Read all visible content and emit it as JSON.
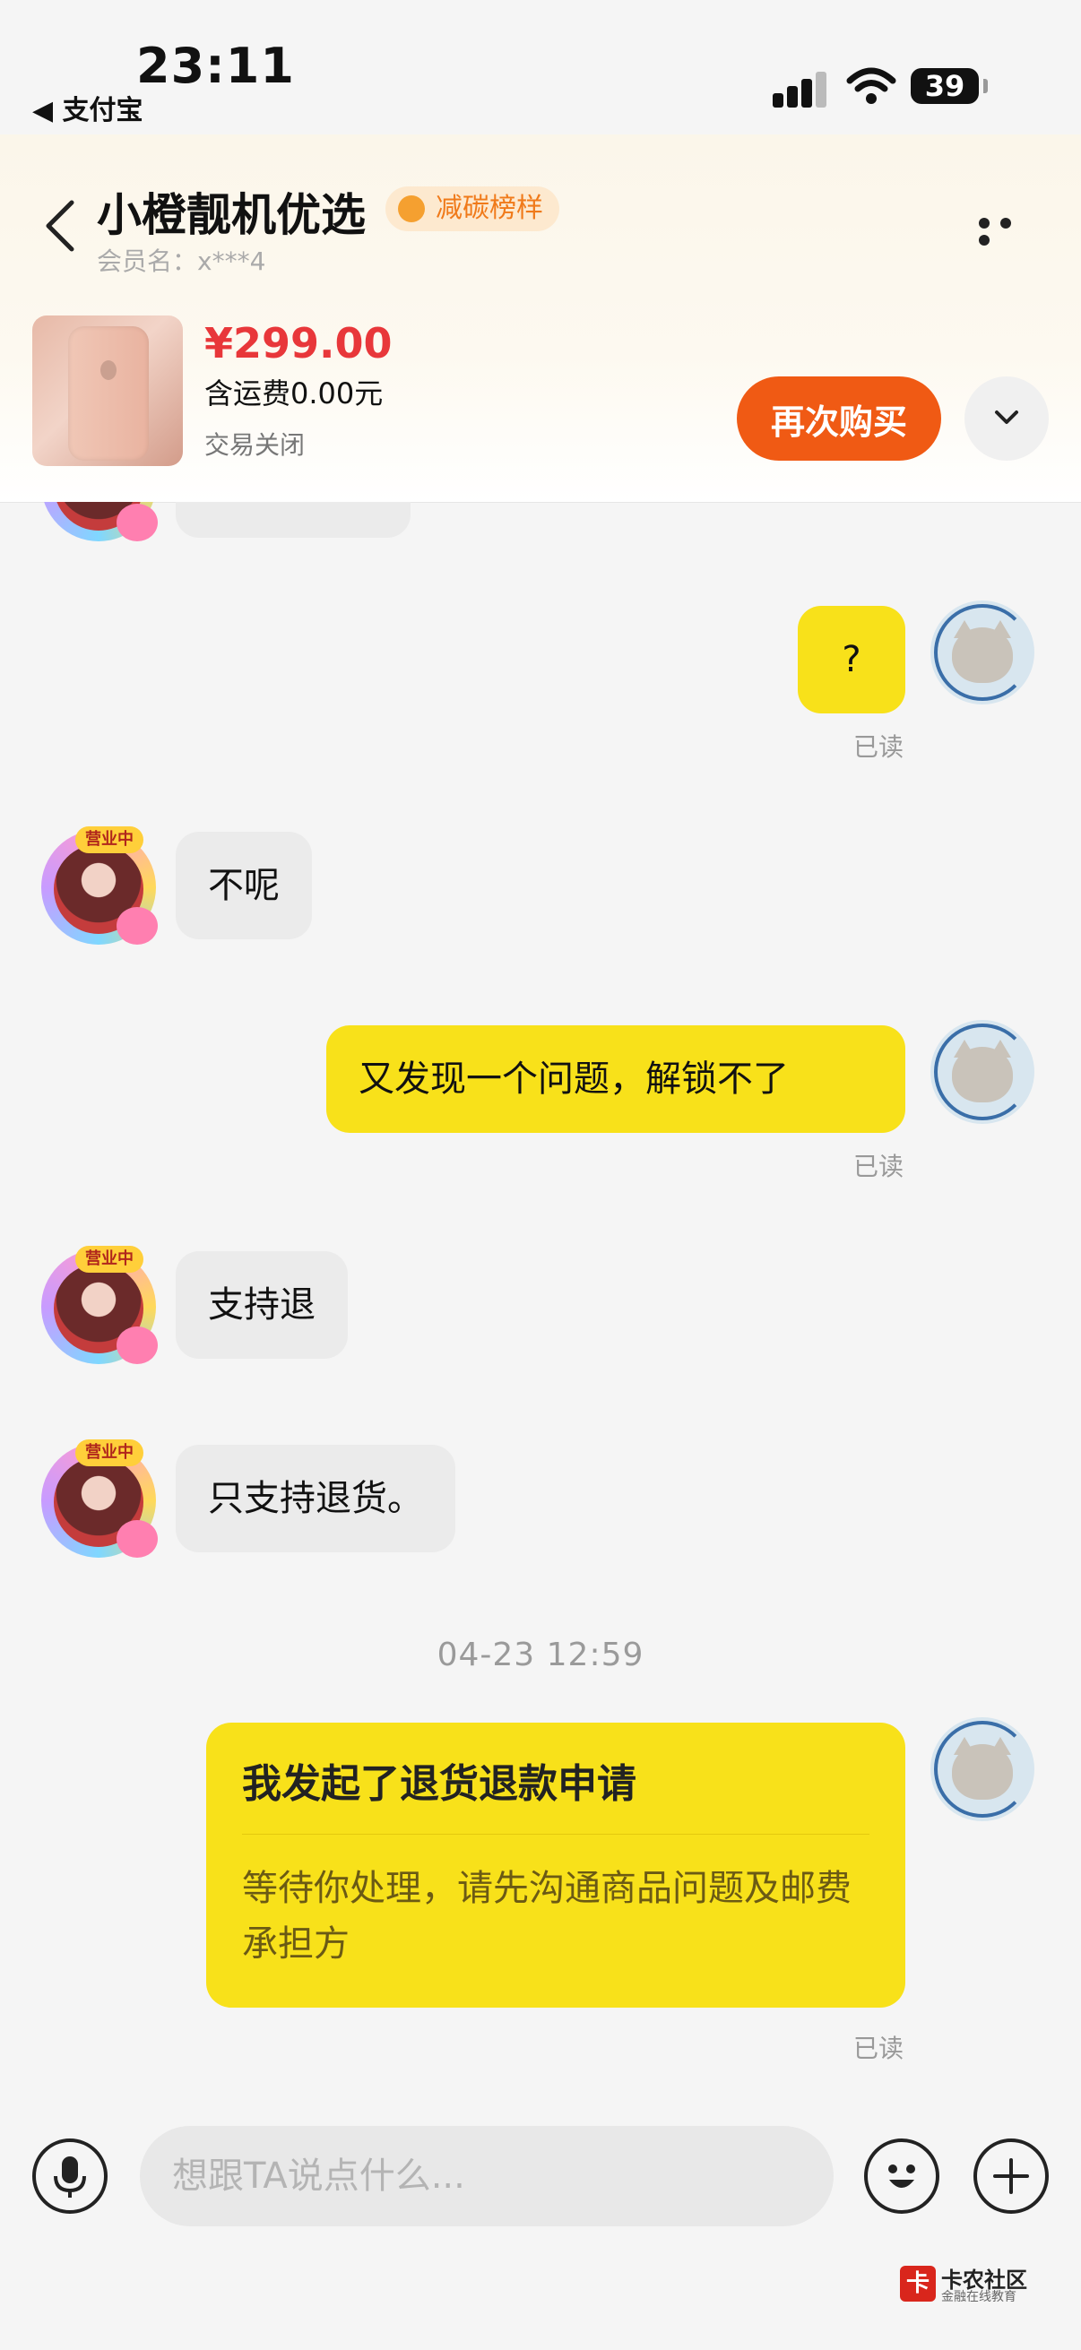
{
  "status_bar": {
    "time": "23:11",
    "back_app": "◀ 支付宝",
    "battery": "39"
  },
  "header": {
    "shop_name": "小橙靓机优选",
    "badge": "减碳榜样",
    "member": "会员名：x***4",
    "more": "more-icon"
  },
  "product": {
    "price": "¥299.00",
    "shipping": "含运费0.00元",
    "status": "交易关闭",
    "buy_again": "再次购买"
  },
  "chat": {
    "messages": [
      {
        "side": "out",
        "text": "?",
        "read": "已读"
      },
      {
        "side": "in",
        "text": "不呢",
        "avatar_tag": "营业中"
      },
      {
        "side": "out",
        "text": "又发现一个问题，解锁不了",
        "read": "已读"
      },
      {
        "side": "in",
        "text": "支持退",
        "avatar_tag": "营业中"
      },
      {
        "side": "in",
        "text": "只支持退货。",
        "avatar_tag": "营业中"
      }
    ],
    "timestamp": "04-23 12:59",
    "card": {
      "title": "我发起了退货退款申请",
      "desc": "等待你处理，请先沟通商品问题及邮费承担方",
      "read": "已读"
    }
  },
  "input": {
    "placeholder": "想跟TA说点什么..."
  },
  "watermark": {
    "mark": "卡",
    "title": "卡农社区",
    "subtitle": "金融在线教育"
  },
  "colors": {
    "accent": "#f05a14",
    "bubble_out": "#f8e11a",
    "price": "#e8373a"
  }
}
